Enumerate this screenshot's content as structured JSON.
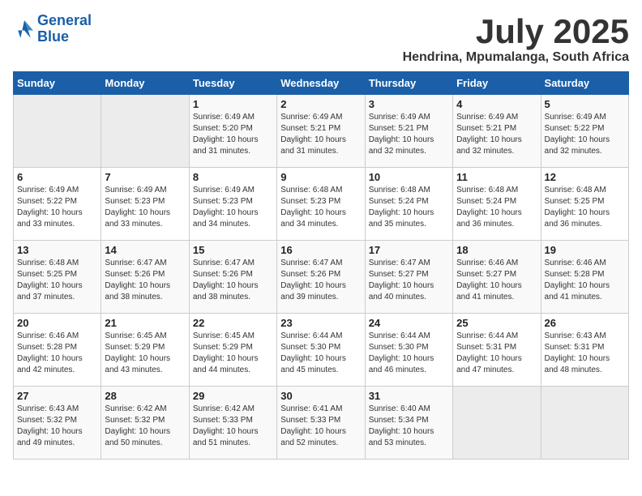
{
  "header": {
    "logo_line1": "General",
    "logo_line2": "Blue",
    "title": "July 2025",
    "subtitle": "Hendrina, Mpumalanga, South Africa"
  },
  "weekdays": [
    "Sunday",
    "Monday",
    "Tuesday",
    "Wednesday",
    "Thursday",
    "Friday",
    "Saturday"
  ],
  "weeks": [
    [
      {
        "day": "",
        "info": ""
      },
      {
        "day": "",
        "info": ""
      },
      {
        "day": "1",
        "info": "Sunrise: 6:49 AM\nSunset: 5:20 PM\nDaylight: 10 hours\nand 31 minutes."
      },
      {
        "day": "2",
        "info": "Sunrise: 6:49 AM\nSunset: 5:21 PM\nDaylight: 10 hours\nand 31 minutes."
      },
      {
        "day": "3",
        "info": "Sunrise: 6:49 AM\nSunset: 5:21 PM\nDaylight: 10 hours\nand 32 minutes."
      },
      {
        "day": "4",
        "info": "Sunrise: 6:49 AM\nSunset: 5:21 PM\nDaylight: 10 hours\nand 32 minutes."
      },
      {
        "day": "5",
        "info": "Sunrise: 6:49 AM\nSunset: 5:22 PM\nDaylight: 10 hours\nand 32 minutes."
      }
    ],
    [
      {
        "day": "6",
        "info": "Sunrise: 6:49 AM\nSunset: 5:22 PM\nDaylight: 10 hours\nand 33 minutes."
      },
      {
        "day": "7",
        "info": "Sunrise: 6:49 AM\nSunset: 5:23 PM\nDaylight: 10 hours\nand 33 minutes."
      },
      {
        "day": "8",
        "info": "Sunrise: 6:49 AM\nSunset: 5:23 PM\nDaylight: 10 hours\nand 34 minutes."
      },
      {
        "day": "9",
        "info": "Sunrise: 6:48 AM\nSunset: 5:23 PM\nDaylight: 10 hours\nand 34 minutes."
      },
      {
        "day": "10",
        "info": "Sunrise: 6:48 AM\nSunset: 5:24 PM\nDaylight: 10 hours\nand 35 minutes."
      },
      {
        "day": "11",
        "info": "Sunrise: 6:48 AM\nSunset: 5:24 PM\nDaylight: 10 hours\nand 36 minutes."
      },
      {
        "day": "12",
        "info": "Sunrise: 6:48 AM\nSunset: 5:25 PM\nDaylight: 10 hours\nand 36 minutes."
      }
    ],
    [
      {
        "day": "13",
        "info": "Sunrise: 6:48 AM\nSunset: 5:25 PM\nDaylight: 10 hours\nand 37 minutes."
      },
      {
        "day": "14",
        "info": "Sunrise: 6:47 AM\nSunset: 5:26 PM\nDaylight: 10 hours\nand 38 minutes."
      },
      {
        "day": "15",
        "info": "Sunrise: 6:47 AM\nSunset: 5:26 PM\nDaylight: 10 hours\nand 38 minutes."
      },
      {
        "day": "16",
        "info": "Sunrise: 6:47 AM\nSunset: 5:26 PM\nDaylight: 10 hours\nand 39 minutes."
      },
      {
        "day": "17",
        "info": "Sunrise: 6:47 AM\nSunset: 5:27 PM\nDaylight: 10 hours\nand 40 minutes."
      },
      {
        "day": "18",
        "info": "Sunrise: 6:46 AM\nSunset: 5:27 PM\nDaylight: 10 hours\nand 41 minutes."
      },
      {
        "day": "19",
        "info": "Sunrise: 6:46 AM\nSunset: 5:28 PM\nDaylight: 10 hours\nand 41 minutes."
      }
    ],
    [
      {
        "day": "20",
        "info": "Sunrise: 6:46 AM\nSunset: 5:28 PM\nDaylight: 10 hours\nand 42 minutes."
      },
      {
        "day": "21",
        "info": "Sunrise: 6:45 AM\nSunset: 5:29 PM\nDaylight: 10 hours\nand 43 minutes."
      },
      {
        "day": "22",
        "info": "Sunrise: 6:45 AM\nSunset: 5:29 PM\nDaylight: 10 hours\nand 44 minutes."
      },
      {
        "day": "23",
        "info": "Sunrise: 6:44 AM\nSunset: 5:30 PM\nDaylight: 10 hours\nand 45 minutes."
      },
      {
        "day": "24",
        "info": "Sunrise: 6:44 AM\nSunset: 5:30 PM\nDaylight: 10 hours\nand 46 minutes."
      },
      {
        "day": "25",
        "info": "Sunrise: 6:44 AM\nSunset: 5:31 PM\nDaylight: 10 hours\nand 47 minutes."
      },
      {
        "day": "26",
        "info": "Sunrise: 6:43 AM\nSunset: 5:31 PM\nDaylight: 10 hours\nand 48 minutes."
      }
    ],
    [
      {
        "day": "27",
        "info": "Sunrise: 6:43 AM\nSunset: 5:32 PM\nDaylight: 10 hours\nand 49 minutes."
      },
      {
        "day": "28",
        "info": "Sunrise: 6:42 AM\nSunset: 5:32 PM\nDaylight: 10 hours\nand 50 minutes."
      },
      {
        "day": "29",
        "info": "Sunrise: 6:42 AM\nSunset: 5:33 PM\nDaylight: 10 hours\nand 51 minutes."
      },
      {
        "day": "30",
        "info": "Sunrise: 6:41 AM\nSunset: 5:33 PM\nDaylight: 10 hours\nand 52 minutes."
      },
      {
        "day": "31",
        "info": "Sunrise: 6:40 AM\nSunset: 5:34 PM\nDaylight: 10 hours\nand 53 minutes."
      },
      {
        "day": "",
        "info": ""
      },
      {
        "day": "",
        "info": ""
      }
    ]
  ]
}
